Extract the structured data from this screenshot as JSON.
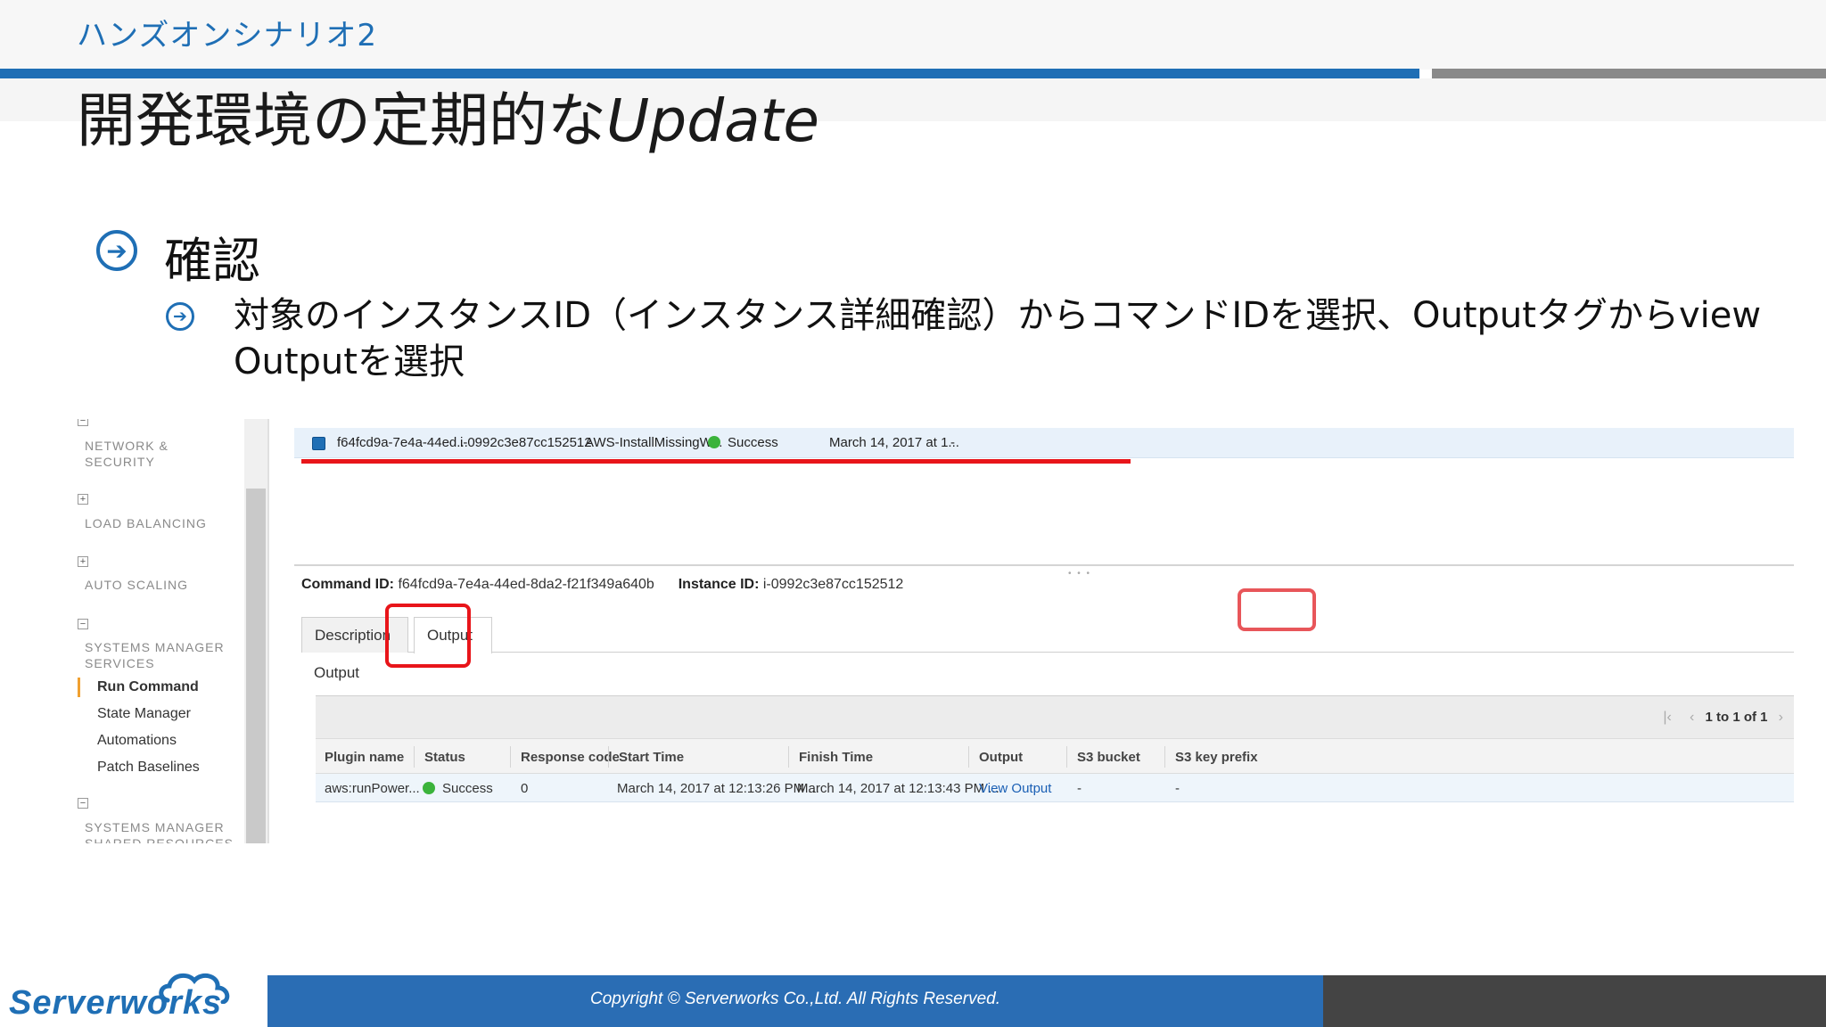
{
  "header": {
    "scenario": "ハンズオンシナリオ2",
    "title_jp": "開発環境の定期的な",
    "title_en": "Update"
  },
  "bullets": {
    "level1": "確認",
    "level2": "対象のインスタンスID（インスタンス詳細確認）からコマンドIDを選択、Outputタグからview Outputを選択"
  },
  "sidebar": {
    "sections": [
      {
        "title": "NETWORK &\nSECURITY",
        "icon": "minus"
      },
      {
        "title": "LOAD BALANCING",
        "icon": "plus"
      },
      {
        "title": "AUTO SCALING",
        "icon": "plus"
      },
      {
        "title": "SYSTEMS MANAGER\nSERVICES",
        "icon": "minus"
      },
      {
        "title": "SYSTEMS MANAGER\nSHARED RESOURCES",
        "icon": "minus"
      }
    ],
    "items": [
      {
        "label": "Run Command",
        "active": true
      },
      {
        "label": "State Manager"
      },
      {
        "label": "Automations"
      },
      {
        "label": "Patch Baselines"
      }
    ]
  },
  "command_row": {
    "command_id": "f64fcd9a-7e4a-44ed...",
    "instance_id": "i-0992c3e87cc152512",
    "document": "AWS-InstallMissingW...",
    "status": "Success",
    "requested": "March 14, 2017 at 1...",
    "comment": "-"
  },
  "details": {
    "command_id_label": "Command ID:",
    "command_id_value": "f64fcd9a-7e4a-44ed-8da2-f21f349a640b",
    "instance_id_label": "Instance ID:",
    "instance_id_value": "i-0992c3e87cc152512"
  },
  "tabs": {
    "description": "Description",
    "output": "Output"
  },
  "output_section": {
    "label": "Output",
    "pager": "1 to 1 of 1",
    "columns": [
      "Plugin name",
      "Status",
      "Response code",
      "Start Time",
      "Finish Time",
      "Output",
      "S3 bucket",
      "S3 key prefix"
    ],
    "row": {
      "plugin": "aws:runPower...",
      "status": "Success",
      "response_code": "0",
      "start_time": "March 14, 2017 at 12:13:26 PM ...",
      "finish_time": "March 14, 2017 at 12:13:43 PM ...",
      "output_link": "View Output",
      "s3_bucket": "-",
      "s3_key_prefix": "-"
    }
  },
  "footer": {
    "copyright": "Copyright ©  Serverworks Co.,Ltd. All Rights Reserved.",
    "logo": "Serverworks"
  },
  "colors": {
    "accent": "#1f6fb5",
    "highlight": "#e8151a",
    "success": "#3bb33b"
  }
}
